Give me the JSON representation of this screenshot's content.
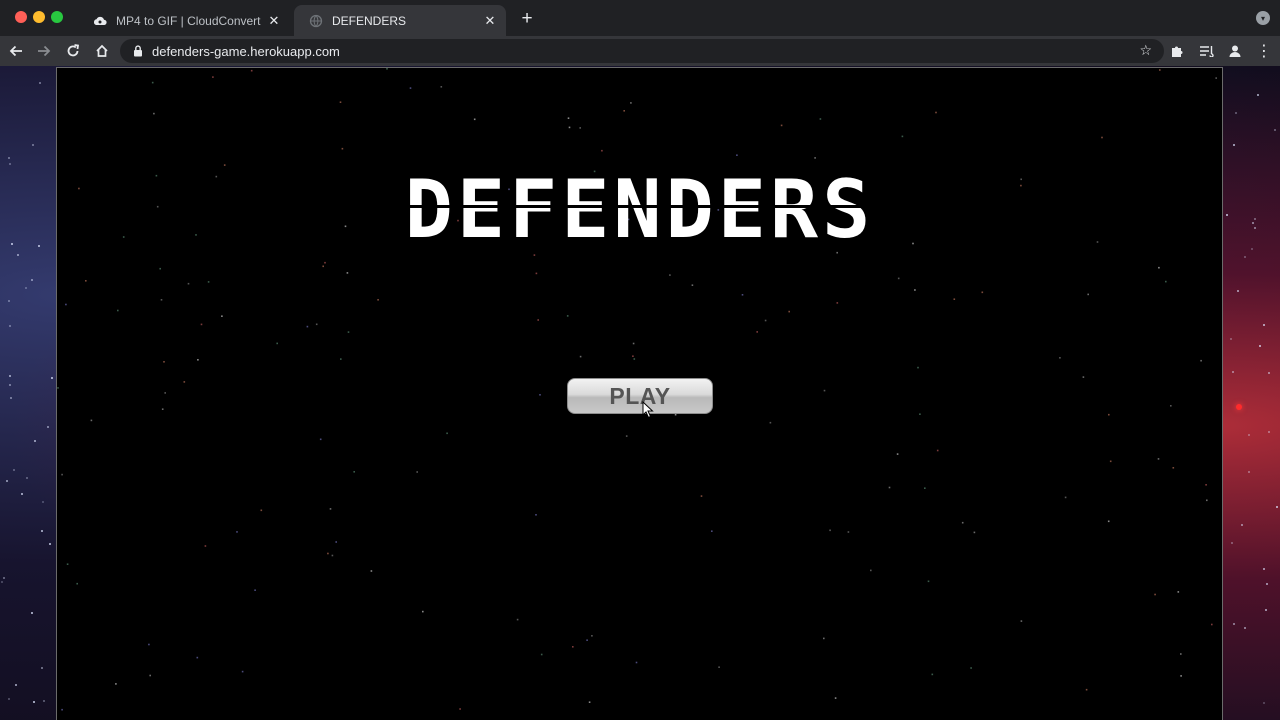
{
  "browser": {
    "tabs": [
      {
        "label": "MP4 to GIF | CloudConvert",
        "favicon": "cloud-icon",
        "active": false
      },
      {
        "label": "DEFENDERS",
        "favicon": "globe-icon",
        "active": true
      }
    ],
    "address": "defenders-game.herokuapp.com",
    "new_tab_glyph": "+",
    "close_glyph": "✕"
  },
  "game": {
    "title": "DEFENDERS",
    "play_label": "PLAY",
    "colors": {
      "canvas": "#000000",
      "title": "#ffffff",
      "button_text": "#555555"
    }
  }
}
